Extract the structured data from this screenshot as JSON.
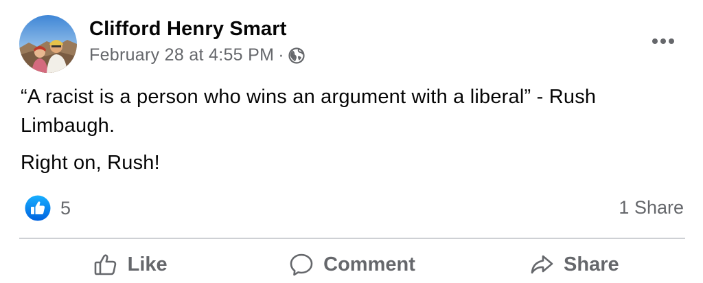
{
  "post": {
    "author": "Clifford Henry Smart",
    "date": "February 28 at 4:55 PM",
    "separator": "·",
    "privacy_icon": "globe-icon",
    "paragraphs": [
      "“A racist is a person who wins an argument with a liberal” - Rush Limbaugh.",
      "Right on, Rush!"
    ],
    "reaction_icon": "like-reaction-icon",
    "reaction_count": "5",
    "share_count": "1 Share"
  },
  "actions": {
    "like_label": "Like",
    "comment_label": "Comment",
    "share_label": "Share"
  },
  "colors": {
    "text_primary": "#050505",
    "text_secondary": "#65676b",
    "like_blue": "#1877f2",
    "divider": "#ced0d4"
  }
}
